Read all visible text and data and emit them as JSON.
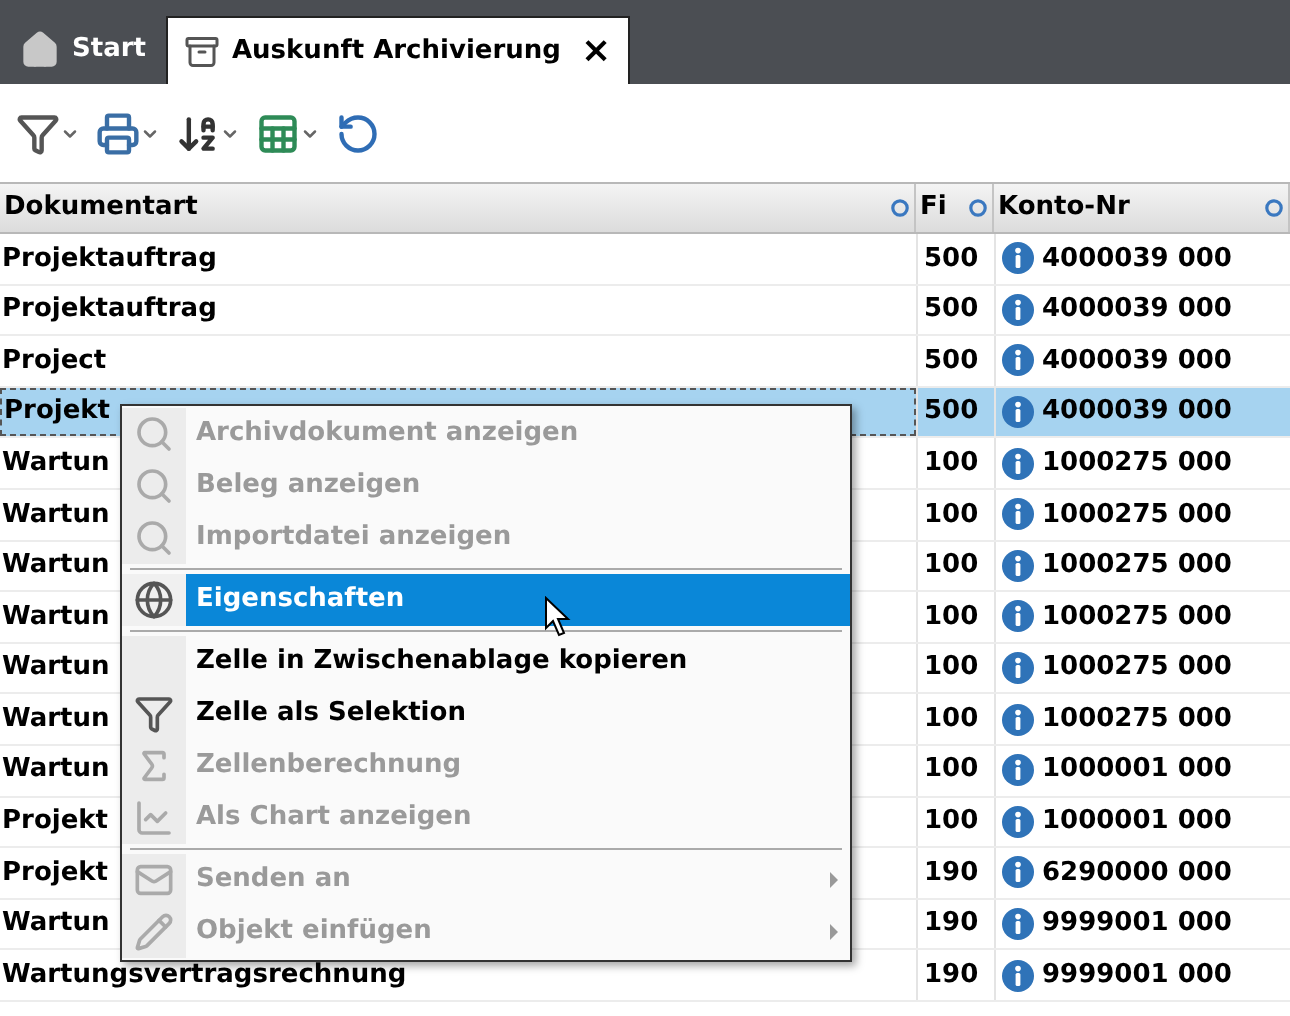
{
  "tabs": [
    {
      "label": "Start",
      "kind": "home",
      "selected": false
    },
    {
      "label": "Auskunft Archivierung",
      "kind": "archive",
      "selected": true,
      "close": "×"
    }
  ],
  "toolbar": [
    {
      "kind": "filter"
    },
    {
      "kind": "print"
    },
    {
      "kind": "sort"
    },
    {
      "kind": "excel"
    },
    {
      "kind": "refresh"
    }
  ],
  "table": {
    "columns": [
      "Dokumentart",
      "Fi",
      "Konto-Nr"
    ],
    "rows": [
      {
        "dokumentart": "Projektauftrag",
        "fi": "500",
        "konto": "4000039 000",
        "selected": false
      },
      {
        "dokumentart": "Projektauftrag",
        "fi": "500",
        "konto": "4000039 000",
        "selected": false
      },
      {
        "dokumentart": "Project",
        "fi": "500",
        "konto": "4000039 000",
        "selected": false
      },
      {
        "dokumentart": "Projekt",
        "fi": "500",
        "konto": "4000039 000",
        "selected": true
      },
      {
        "dokumentart": "Wartun",
        "fi": "100",
        "konto": "1000275 000",
        "selected": false
      },
      {
        "dokumentart": "Wartun",
        "fi": "100",
        "konto": "1000275 000",
        "selected": false
      },
      {
        "dokumentart": "Wartun",
        "fi": "100",
        "konto": "1000275 000",
        "selected": false
      },
      {
        "dokumentart": "Wartun",
        "fi": "100",
        "konto": "1000275 000",
        "selected": false
      },
      {
        "dokumentart": "Wartun",
        "fi": "100",
        "konto": "1000275 000",
        "selected": false
      },
      {
        "dokumentart": "Wartun",
        "fi": "100",
        "konto": "1000275 000",
        "selected": false
      },
      {
        "dokumentart": "Wartun",
        "fi": "100",
        "konto": "1000001 000",
        "selected": false
      },
      {
        "dokumentart": "Projekt",
        "fi": "100",
        "konto": "1000001 000",
        "selected": false
      },
      {
        "dokumentart": "Projekt",
        "fi": "190",
        "konto": "6290000 000",
        "selected": false
      },
      {
        "dokumentart": "Wartun",
        "fi": "190",
        "konto": "9999001 000",
        "selected": false
      },
      {
        "dokumentart": "Wartungsvertragsrechnung",
        "fi": "190",
        "konto": "9999001 000",
        "selected": false
      }
    ]
  },
  "context_menu": {
    "items": [
      {
        "label": "Archivdokument anzeigen",
        "kind": "search",
        "disabled": true,
        "selected": false,
        "submenu": false,
        "separator_after": false
      },
      {
        "label": "Beleg anzeigen",
        "kind": "search",
        "disabled": true,
        "selected": false,
        "submenu": false,
        "separator_after": false
      },
      {
        "label": "Importdatei anzeigen",
        "kind": "search",
        "disabled": true,
        "selected": false,
        "submenu": false,
        "separator_after": true
      },
      {
        "label": "Eigenschaften",
        "kind": "globe",
        "disabled": false,
        "selected": true,
        "submenu": false,
        "separator_after": true
      },
      {
        "label": "Zelle in Zwischenablage kopieren",
        "kind": "plain",
        "disabled": false,
        "selected": false,
        "submenu": false,
        "separator_after": false
      },
      {
        "label": "Zelle als Selektion",
        "kind": "filter",
        "disabled": false,
        "selected": false,
        "submenu": false,
        "separator_after": false
      },
      {
        "label": "Zellenberechnung",
        "kind": "sigma",
        "disabled": true,
        "selected": false,
        "submenu": false,
        "separator_after": false
      },
      {
        "label": "Als Chart anzeigen",
        "kind": "chart",
        "disabled": true,
        "selected": false,
        "submenu": false,
        "separator_after": true
      },
      {
        "label": "Senden an",
        "kind": "mail",
        "disabled": true,
        "selected": false,
        "submenu": true,
        "separator_after": false
      },
      {
        "label": "Objekt einfügen",
        "kind": "pencil",
        "disabled": true,
        "selected": false,
        "submenu": true,
        "separator_after": false
      }
    ]
  }
}
